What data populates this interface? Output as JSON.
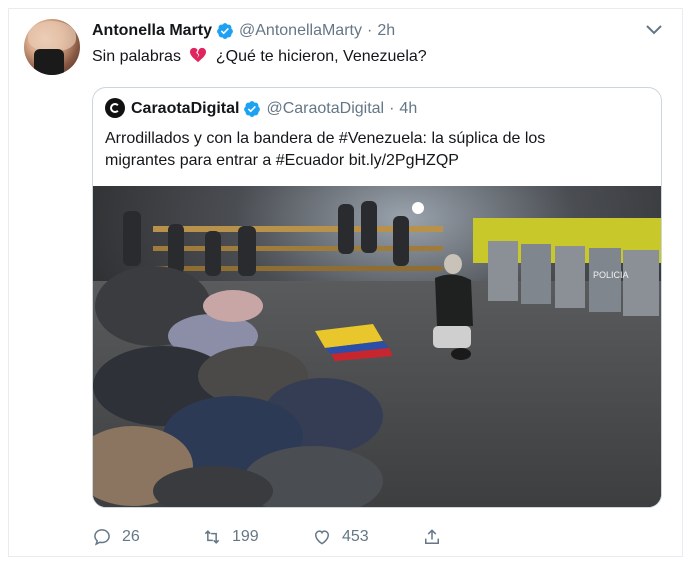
{
  "tweet": {
    "author_name": "Antonella Marty",
    "author_handle": "@AntonellaMarty",
    "separator": "·",
    "time": "2h",
    "text_before": "Sin palabras",
    "text_after": "¿Qué te hicieron, Venezuela?",
    "icons": {
      "verified": "verified-badge-icon",
      "emoji": "broken-heart-icon",
      "menu": "chevron-down-icon"
    }
  },
  "quoted": {
    "author_name": "CaraotaDigital",
    "author_handle": "@CaraotaDigital",
    "separator": "·",
    "time": "4h",
    "text_line1": "Arrodillados y con la bandera de #Venezuela: la súplica de los",
    "text_line2": "migrantes para entrar a #Ecuador bit.ly/2PgHZQP",
    "photo_sign": "POLICIA"
  },
  "actions": {
    "replies": "26",
    "retweets": "199",
    "likes": "453"
  },
  "colors": {
    "accent": "#1da1f2",
    "text": "#14171a",
    "muted": "#657786",
    "heart": "#e0245e"
  }
}
